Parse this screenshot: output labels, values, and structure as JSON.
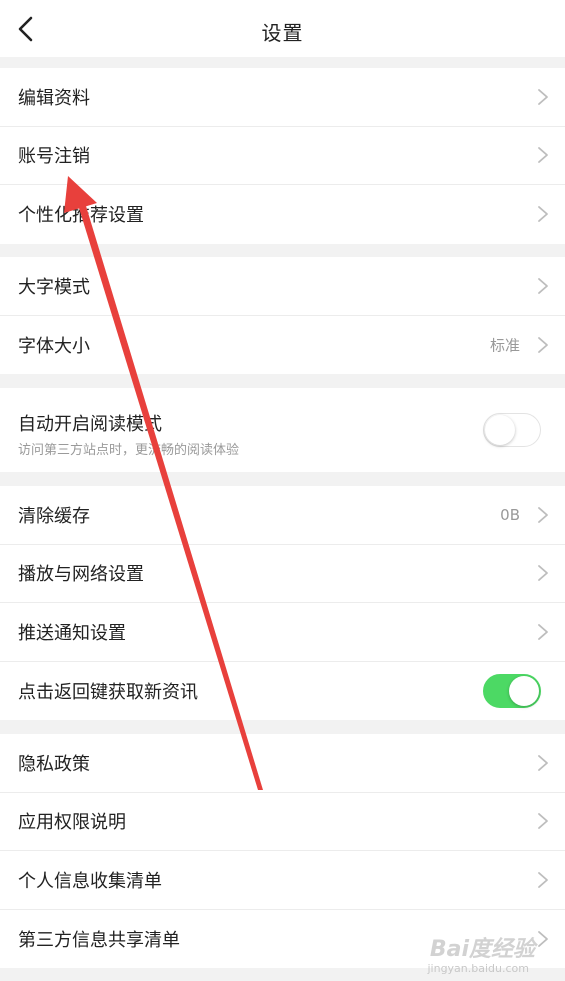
{
  "header": {
    "title": "设置",
    "back_icon": "chevron-left-icon"
  },
  "sections": [
    {
      "items": [
        {
          "label": "编辑资料"
        },
        {
          "label": "账号注销"
        },
        {
          "label": "个性化推荐设置"
        }
      ]
    },
    {
      "items": [
        {
          "label": "大字模式"
        },
        {
          "label": "字体大小",
          "value": "标准"
        }
      ]
    },
    {
      "items": [
        {
          "label": "自动开启阅读模式",
          "subtitle": "访问第三方站点时，更流畅的阅读体验",
          "toggle": "off"
        }
      ]
    },
    {
      "items": [
        {
          "label": "清除缓存",
          "value": "0B"
        },
        {
          "label": "播放与网络设置"
        },
        {
          "label": "推送通知设置"
        },
        {
          "label": "点击返回键获取新资讯",
          "toggle": "on"
        }
      ]
    },
    {
      "items": [
        {
          "label": "隐私政策"
        },
        {
          "label": "应用权限说明"
        },
        {
          "label": "个人信息收集清单"
        },
        {
          "label": "第三方信息共享清单"
        }
      ]
    }
  ],
  "colors": {
    "toggle_on": "#4cd964",
    "annotation_arrow": "#e8403c",
    "background": "#f2f2f2"
  },
  "watermark": {
    "main": "Bai度经验",
    "sub": "jingyan.baidu.com"
  }
}
